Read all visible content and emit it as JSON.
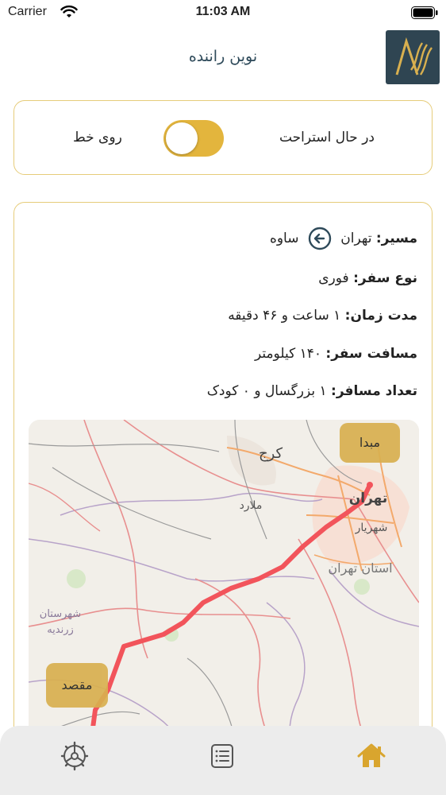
{
  "status_bar": {
    "carrier": "Carrier",
    "time": "11:03 AM"
  },
  "header": {
    "title": "نوین راننده",
    "logo_icon": "app-logo-icon"
  },
  "driver_status": {
    "resting_label": "در حال استراحت",
    "online_label": "روی خط",
    "toggle_state": "online",
    "toggle_color": "#e3b53d"
  },
  "trip": {
    "route": {
      "label": "مسیر:",
      "from": "تهران",
      "to": "ساوه",
      "arrow_icon": "arrow-left-circle-icon"
    },
    "trip_type": {
      "label": "نوع سفر:",
      "value": "فوری"
    },
    "duration": {
      "label": "مدت زمان:",
      "value": "۱ ساعت و ۴۶ دقیقه"
    },
    "distance": {
      "label": "مسافت سفر:",
      "value": "۱۴۰ کیلومتر"
    },
    "passengers": {
      "label": "تعداد مسافر:",
      "value": "۱ بزرگسال و ۰ کودک"
    }
  },
  "map": {
    "origin_label": "مبدا",
    "destination_label": "مقصد",
    "route_color": "#f2545b",
    "pin_color": "#d9b04f",
    "place_labels": {
      "karaj": "کرج",
      "tehran": "تهران",
      "malard": "ملارد",
      "shahriar": "شهریار",
      "tehran_province": "استان تهران",
      "zarandieh_county": "شهرستان",
      "zarandieh": "زرندیه"
    }
  },
  "tab_bar": {
    "items": [
      {
        "icon": "settings-gear-icon"
      },
      {
        "icon": "list-icon"
      },
      {
        "icon": "home-icon",
        "active": true
      }
    ],
    "active_color": "#d9a52e"
  }
}
